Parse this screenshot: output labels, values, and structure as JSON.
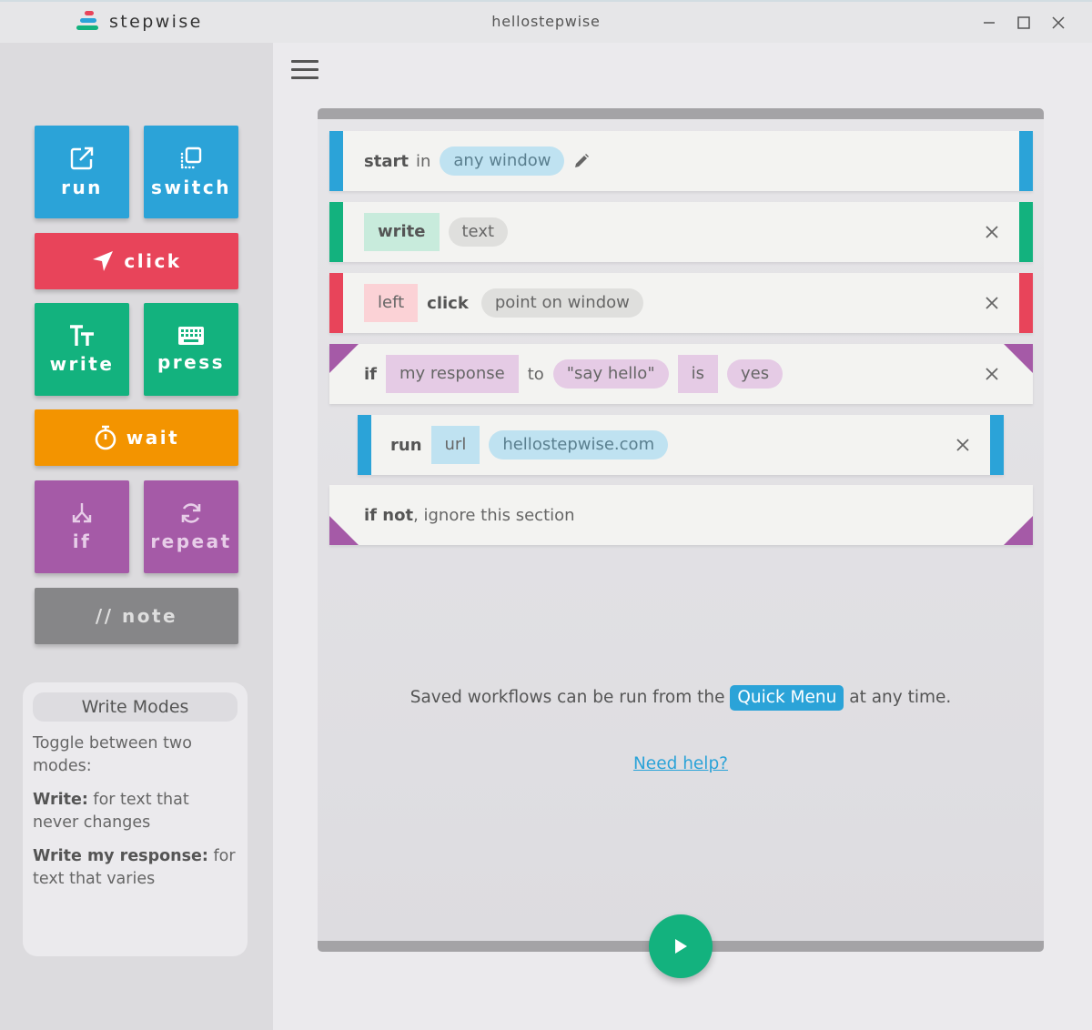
{
  "app": {
    "name": "stepwise",
    "window_title": "hellostepwise"
  },
  "colors": {
    "blue": "#2ba3d8",
    "red": "#e8445a",
    "green": "#13b27e",
    "orange": "#f39400",
    "purple": "#a55aa7",
    "gray": "#868688"
  },
  "sidebar": {
    "tiles": {
      "run": "run",
      "switch": "switch",
      "click": "click",
      "write": "write",
      "press": "press",
      "wait": "wait",
      "if": "if",
      "repeat": "repeat",
      "note": "// note"
    },
    "help": {
      "title": "Write Modes",
      "intro": "Toggle between two modes:",
      "write_label": "Write:",
      "write_desc": " for text that never changes",
      "response_label": "Write my response:",
      "response_desc": " for text that varies"
    }
  },
  "workflow": {
    "start": {
      "keyword": "start",
      "in": "in",
      "window": "any window"
    },
    "write": {
      "keyword": "write",
      "value": "text"
    },
    "click": {
      "button": "left",
      "keyword": "click",
      "target": "point on window"
    },
    "if": {
      "keyword": "if",
      "var": "my response",
      "to": "to",
      "prompt": "\"say hello\"",
      "is": "is",
      "value": "yes"
    },
    "run": {
      "keyword": "run",
      "type": "url",
      "value": "hellostepwise.com"
    },
    "if_not": {
      "keyword": "if not",
      "rest": ", ignore this section"
    }
  },
  "info": {
    "before": "Saved workflows can be run from the ",
    "quick_menu": "Quick Menu",
    "after": " at any time."
  },
  "help_link": "Need help?"
}
